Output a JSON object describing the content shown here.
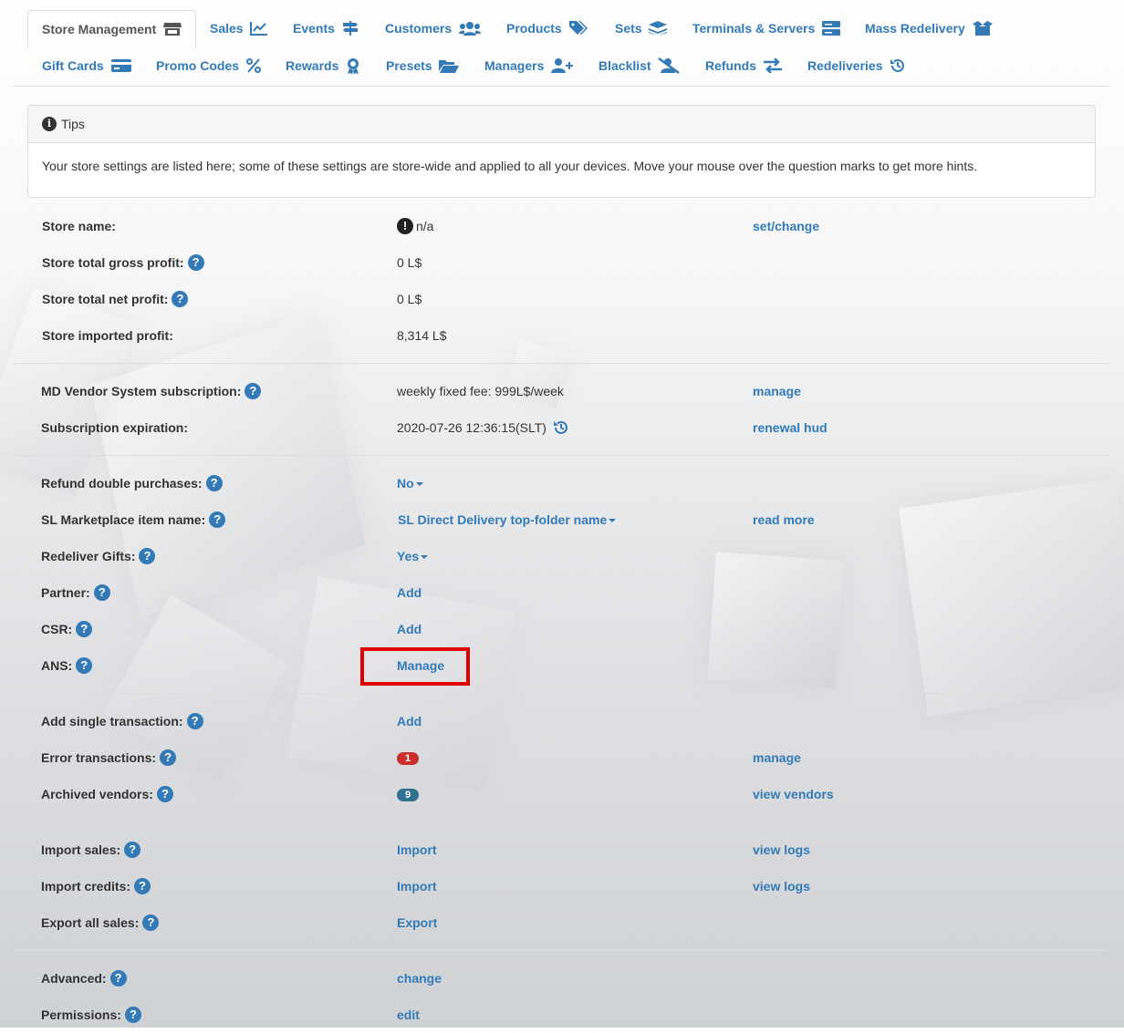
{
  "nav": {
    "row1": [
      {
        "label": "Store Management",
        "icon": "store-icon",
        "active": true
      },
      {
        "label": "Sales",
        "icon": "line-chart-icon"
      },
      {
        "label": "Events",
        "icon": "signpost-icon"
      },
      {
        "label": "Customers",
        "icon": "users-icon"
      },
      {
        "label": "Products",
        "icon": "tags-icon"
      },
      {
        "label": "Sets",
        "icon": "layers-icon"
      },
      {
        "label": "Terminals & Servers",
        "icon": "server-icon"
      },
      {
        "label": "Mass Redelivery",
        "icon": "box-open-icon"
      }
    ],
    "row2": [
      {
        "label": "Gift Cards",
        "icon": "credit-card-icon"
      },
      {
        "label": "Promo Codes",
        "icon": "percent-icon"
      },
      {
        "label": "Rewards",
        "icon": "award-icon"
      },
      {
        "label": "Presets",
        "icon": "folder-open-icon"
      },
      {
        "label": "Managers",
        "icon": "user-plus-icon"
      },
      {
        "label": "Blacklist",
        "icon": "user-slash-icon"
      },
      {
        "label": "Refunds",
        "icon": "exchange-icon"
      },
      {
        "label": "Redeliveries",
        "icon": "history-icon"
      }
    ]
  },
  "tips": {
    "title": "Tips",
    "text": "Your store settings are listed here; some of these settings are store-wide and applied to all your devices. Move your mouse over the question marks to get more hints."
  },
  "settings": {
    "store_name": {
      "label": "Store name:",
      "value": "n/a",
      "action": "set/change"
    },
    "gross_profit": {
      "label": "Store total gross profit:",
      "value": "0 L$"
    },
    "net_profit": {
      "label": "Store total net profit:",
      "value": "0 L$"
    },
    "imported_profit": {
      "label": "Store imported profit:",
      "value": "8,314 L$"
    },
    "subscription": {
      "label": "MD Vendor System subscription:",
      "value": "weekly fixed fee: 999L$/week",
      "action": "manage"
    },
    "expiration": {
      "label": "Subscription expiration:",
      "value": "2020-07-26 12:36:15(SLT)",
      "action": "renewal hud"
    },
    "refund_double": {
      "label": "Refund double purchases:",
      "value": "No"
    },
    "marketplace_name": {
      "label": "SL Marketplace item name:",
      "value": "SL Direct Delivery top-folder name",
      "action": "read more"
    },
    "redeliver_gifts": {
      "label": "Redeliver Gifts:",
      "value": "Yes"
    },
    "partner": {
      "label": "Partner:",
      "value": "Add"
    },
    "csr": {
      "label": "CSR:",
      "value": "Add"
    },
    "ans": {
      "label": "ANS:",
      "value": "Manage"
    },
    "single_tx": {
      "label": "Add single transaction:",
      "value": "Add"
    },
    "error_tx": {
      "label": "Error transactions:",
      "value": "1",
      "action": "manage"
    },
    "archived": {
      "label": "Archived vendors:",
      "value": "9",
      "action": "view vendors"
    },
    "import_sales": {
      "label": "Import sales:",
      "value": "Import",
      "action": "view logs"
    },
    "import_credits": {
      "label": "Import credits:",
      "value": "Import",
      "action": "view logs"
    },
    "export_sales": {
      "label": "Export all sales:",
      "value": "Export"
    },
    "advanced": {
      "label": "Advanced:",
      "value": "change"
    },
    "permissions": {
      "label": "Permissions:",
      "value": "edit"
    }
  },
  "colors": {
    "link": "#337ab7",
    "highlight": "#e00000",
    "badge_red": "#c9302c",
    "badge_blue": "#31708f"
  }
}
